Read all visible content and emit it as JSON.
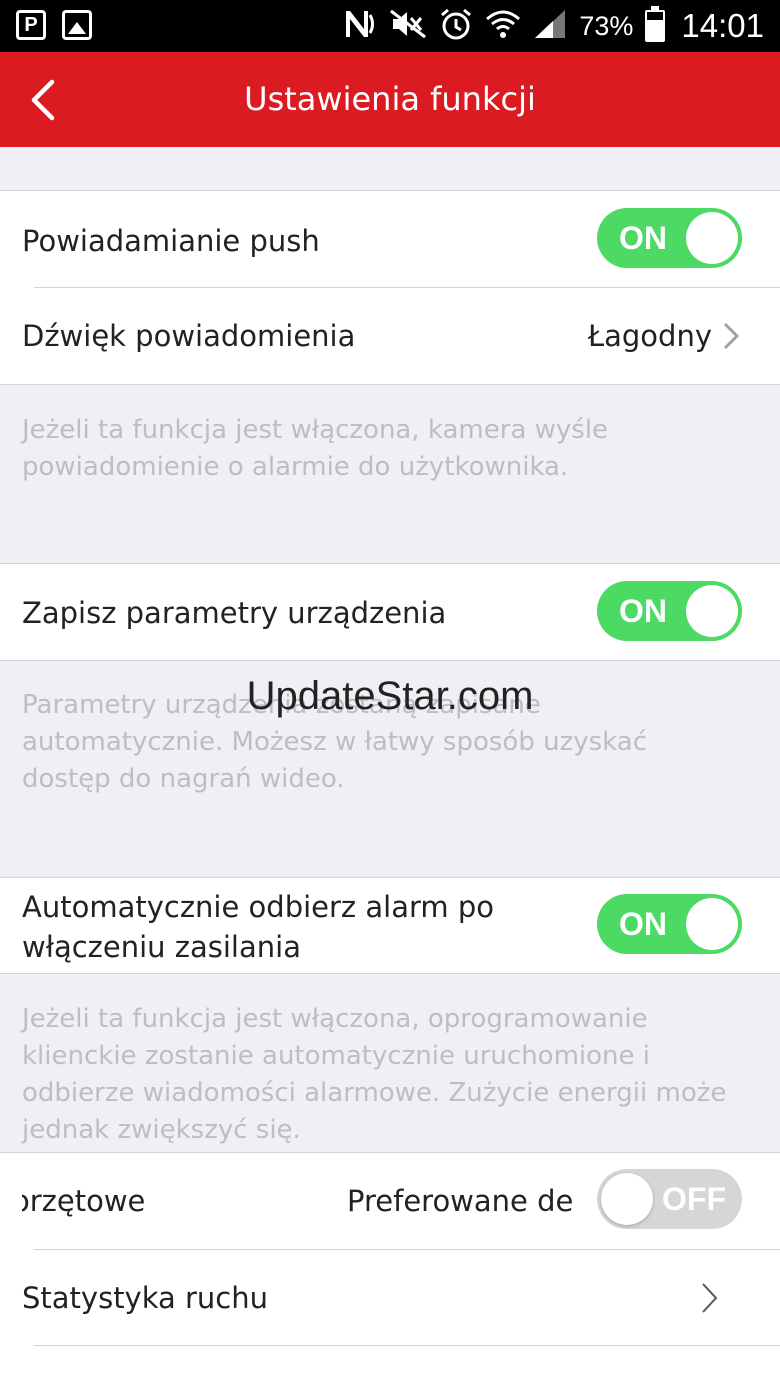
{
  "status_bar": {
    "left_icons": [
      "p-app-icon",
      "image-icon"
    ],
    "left_p_label": "P",
    "right_icons": [
      "nfc-icon",
      "mute-icon",
      "alarm-icon",
      "wifi-icon",
      "signal-icon"
    ],
    "battery_percent_text": "73%",
    "battery_level": 0.73,
    "time": "14:01"
  },
  "header": {
    "title": "Ustawienia funkcji",
    "background": "#db1a21"
  },
  "sections": {
    "push": {
      "label": "Powiadamianie push",
      "toggle": "ON"
    },
    "sound": {
      "label": "Dźwięk powiadomienia",
      "value": "Łagodny"
    },
    "push_desc": "Jeżeli ta funkcja jest włączona, kamera wyśle powiadomienie o alarmie do użytkownika.",
    "save_params": {
      "label": "Zapisz parametry urządzenia",
      "toggle": "ON"
    },
    "save_desc": "Parametry urządzenia zostaną zapisane automatycznie. Możesz w łatwy sposób uzyskać dostęp do nagrań wideo.",
    "auto_alarm": {
      "label_line1": "Automatycznie odbierz alarm po",
      "label_line2": "włączeniu zasilania",
      "toggle": "ON"
    },
    "auto_desc": "Jeżeli ta funkcja jest włączona, oprogramowanie klienckie zostanie automatycznie uruchomione i odbierze wiadomości alarmowe. Zużycie energii może jednak zwiększyć się.",
    "hardware": {
      "label_left": "orzętowe",
      "label_right": "Preferowane de",
      "toggle": "OFF"
    },
    "stats": {
      "label": "Statystyka ruchu"
    }
  },
  "watermark": "UpdateStar.com",
  "colors": {
    "toggle_on": "#4cd964",
    "toggle_off": "#d6d6d6",
    "description_text": "#bdbdc2"
  }
}
